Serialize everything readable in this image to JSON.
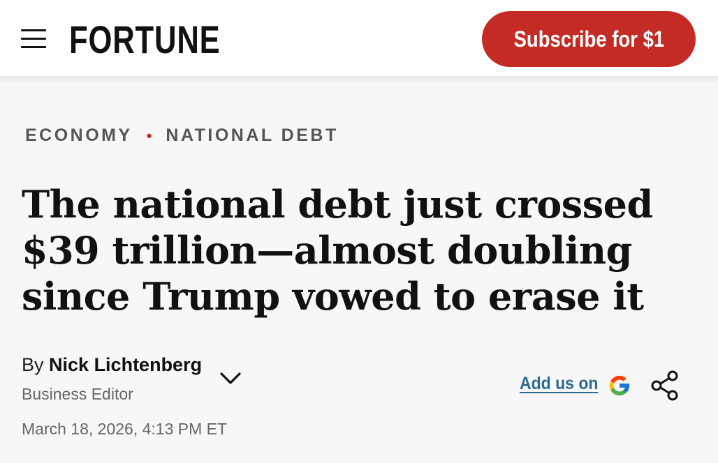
{
  "header": {
    "logo": "FORTUNE",
    "subscribe_label": "Subscribe for $1",
    "icons": {
      "menu": "hamburger-menu-icon"
    }
  },
  "breadcrumb": {
    "items": [
      "ECONOMY",
      "NATIONAL DEBT"
    ],
    "separator": "•"
  },
  "article": {
    "headline": "The national debt just crossed $39 trillion—almost doubling since Trump vowed to erase it",
    "byline_prefix": "By",
    "author": "Nick Lichtenberg",
    "role": "Business Editor",
    "date": "March 18, 2026, 4:13 PM ET",
    "add_us_label": "Add us on",
    "icons": {
      "author_expand": "chevron-down-icon",
      "google": "google-g-icon",
      "share": "share-icon"
    }
  },
  "colors": {
    "brand_red": "#c42b25",
    "link_blue": "#2d6a8e",
    "text": "#111111",
    "muted": "#666666",
    "background": "#f7f7f7"
  }
}
